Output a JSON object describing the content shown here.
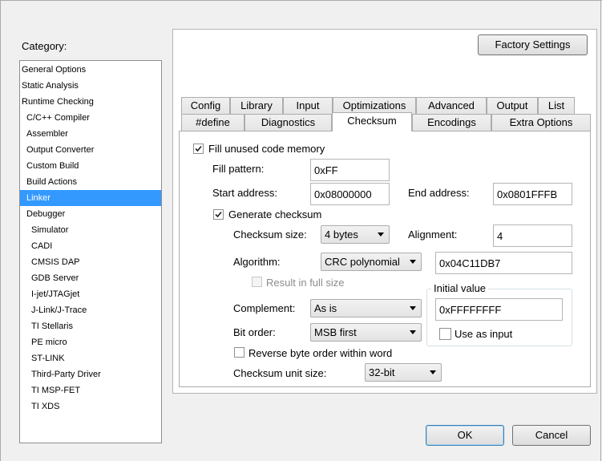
{
  "category": {
    "label": "Category:",
    "items": [
      {
        "label": "General Options",
        "selected": false
      },
      {
        "label": "Static Analysis",
        "selected": false
      },
      {
        "label": "Runtime Checking",
        "selected": false
      },
      {
        "label": "C/C++ Compiler",
        "selected": false
      },
      {
        "label": "Assembler",
        "selected": false
      },
      {
        "label": "Output Converter",
        "selected": false
      },
      {
        "label": "Custom Build",
        "selected": false
      },
      {
        "label": "Build Actions",
        "selected": false
      },
      {
        "label": "Linker",
        "selected": true
      },
      {
        "label": "Debugger",
        "selected": false
      },
      {
        "label": "Simulator",
        "selected": false
      },
      {
        "label": "CADI",
        "selected": false
      },
      {
        "label": "CMSIS DAP",
        "selected": false
      },
      {
        "label": "GDB Server",
        "selected": false
      },
      {
        "label": "I-jet/JTAGjet",
        "selected": false
      },
      {
        "label": "J-Link/J-Trace",
        "selected": false
      },
      {
        "label": "TI Stellaris",
        "selected": false
      },
      {
        "label": "PE micro",
        "selected": false
      },
      {
        "label": "ST-LINK",
        "selected": false
      },
      {
        "label": "Third-Party Driver",
        "selected": false
      },
      {
        "label": "TI MSP-FET",
        "selected": false
      },
      {
        "label": "TI XDS",
        "selected": false
      }
    ]
  },
  "factory_settings_label": "Factory Settings",
  "tabs_row1": [
    "Config",
    "Library",
    "Input",
    "Optimizations",
    "Advanced",
    "Output",
    "List"
  ],
  "tabs_row2": [
    "#define",
    "Diagnostics",
    "Checksum",
    "Encodings",
    "Extra Options"
  ],
  "active_tab": "Checksum",
  "checksum": {
    "fill_unused": {
      "label": "Fill unused code memory",
      "checked": true
    },
    "fill_pattern": {
      "label": "Fill pattern:",
      "value": "0xFF"
    },
    "start_address": {
      "label": "Start address:",
      "value": "0x08000000"
    },
    "end_address": {
      "label": "End address:",
      "value": "0x0801FFFB"
    },
    "generate": {
      "label": "Generate checksum",
      "checked": true
    },
    "checksum_size": {
      "label": "Checksum size:",
      "value": "4 bytes"
    },
    "alignment": {
      "label": "Alignment:",
      "value": "4"
    },
    "algorithm": {
      "label": "Algorithm:",
      "value": "CRC polynomial",
      "poly": "0x04C11DB7"
    },
    "result_full_size": {
      "label": "Result in full size",
      "checked": false,
      "enabled": false
    },
    "initial_value": {
      "title": "Initial value",
      "value": "0xFFFFFFFF",
      "use_as_input_label": "Use as input",
      "use_as_input": false
    },
    "complement": {
      "label": "Complement:",
      "value": "As is"
    },
    "bit_order": {
      "label": "Bit order:",
      "value": "MSB first"
    },
    "reverse_byte_order": {
      "label": "Reverse byte order within word",
      "checked": false
    },
    "unit_size": {
      "label": "Checksum unit size:",
      "value": "32-bit"
    }
  },
  "ok_label": "OK",
  "cancel_label": "Cancel",
  "colors": {
    "selection": "#3399ff",
    "window_bg": "#f0f0f0"
  }
}
